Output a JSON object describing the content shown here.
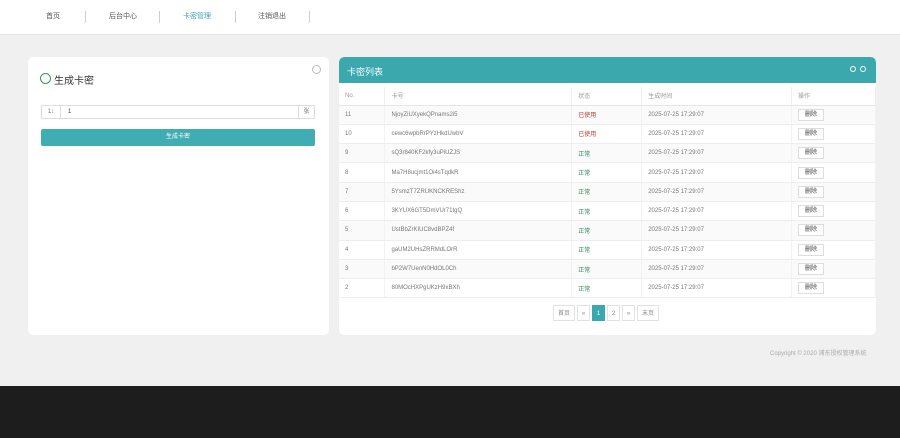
{
  "nav": {
    "items": [
      {
        "label": "首页",
        "active": false
      },
      {
        "label": "后台中心",
        "active": false
      },
      {
        "label": "卡密管理",
        "active": true
      },
      {
        "label": "注销退出",
        "active": false
      }
    ]
  },
  "generate_panel": {
    "title": "生成卡密",
    "quantity_prefix": "1↕",
    "quantity_value": "1",
    "quantity_suffix": "张",
    "button_label": "生成卡密"
  },
  "card_list": {
    "title": "卡密列表",
    "columns": [
      "No.",
      "卡号",
      "状态",
      "生成时间",
      "操作"
    ],
    "rows": [
      {
        "no": "11",
        "code": "NjoyZiUXyekQPnams2i5",
        "status": "已使用",
        "time": "2025-07-25 17:29:07",
        "action": "删除"
      },
      {
        "no": "10",
        "code": "cewc6wpbRrPYzHkdUwbV",
        "status": "已使用",
        "time": "2025-07-25 17:29:07",
        "action": "删除"
      },
      {
        "no": "9",
        "code": "sQ3r840KF2kfy3uPiUZJS",
        "status": "正常",
        "time": "2025-07-25 17:29:07",
        "action": "删除"
      },
      {
        "no": "8",
        "code": "Ma7H8ucjmt1Oi4sTqdkR",
        "status": "正常",
        "time": "2025-07-25 17:29:07",
        "action": "删除"
      },
      {
        "no": "7",
        "code": "5YsmzT7ZRUKNCKREShz",
        "status": "正常",
        "time": "2025-07-25 17:29:07",
        "action": "删除"
      },
      {
        "no": "6",
        "code": "3KYUX6GT5DmVUr71tgQ",
        "status": "正常",
        "time": "2025-07-25 17:29:07",
        "action": "删除"
      },
      {
        "no": "5",
        "code": "UstBbZrKIUC8vdBPZ4f",
        "status": "正常",
        "time": "2025-07-25 17:29:07",
        "action": "删除"
      },
      {
        "no": "4",
        "code": "gaUM2UHsZRRMdLOrR",
        "status": "正常",
        "time": "2025-07-25 17:29:07",
        "action": "删除"
      },
      {
        "no": "3",
        "code": "bP2W7UenN0HdOL0Ch",
        "status": "正常",
        "time": "2025-07-25 17:29:07",
        "action": "删除"
      },
      {
        "no": "2",
        "code": "80MOcHXPgUKzH9xBXh",
        "status": "正常",
        "time": "2025-07-25 17:29:07",
        "action": "删除"
      }
    ],
    "pagination": {
      "first": "首页",
      "prev": "«",
      "current": "1",
      "next_page": "2",
      "next": "»",
      "last": "末页"
    }
  },
  "footer": {
    "copyright": "Copyright © 2020 浦东授权管理系统"
  },
  "colors": {
    "accent": "#3ba8ae",
    "used_status": "#c0392b",
    "ok_status": "#2e8b57"
  }
}
